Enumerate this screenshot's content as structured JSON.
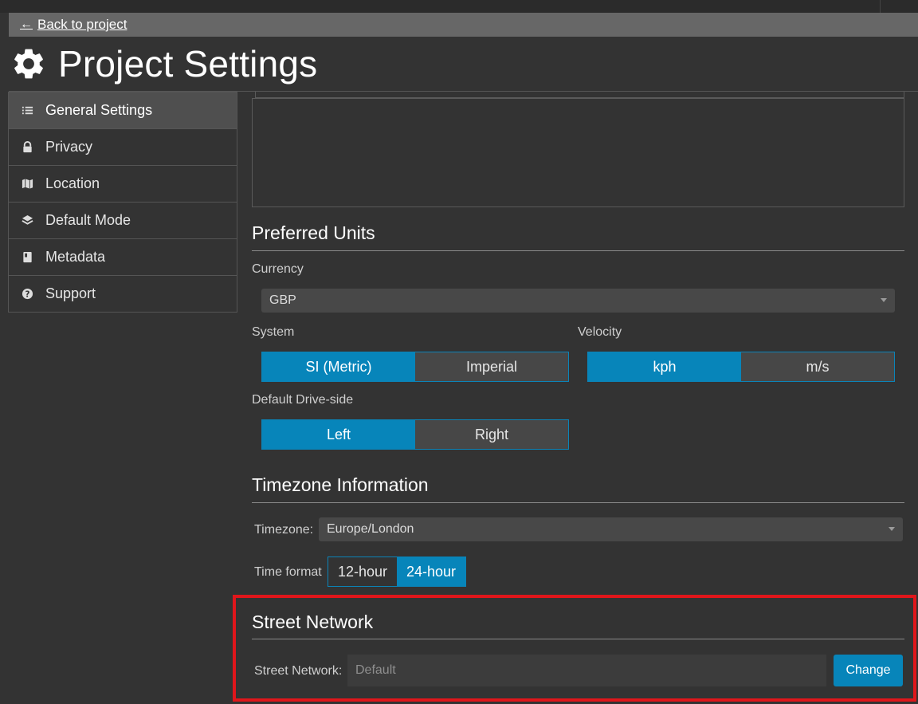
{
  "header": {
    "back_label": "Back to project",
    "page_title": "Project Settings"
  },
  "sidebar": {
    "items": [
      {
        "label": "General Settings",
        "icon": "list-icon",
        "active": true
      },
      {
        "label": "Privacy",
        "icon": "lock-icon",
        "active": false
      },
      {
        "label": "Location",
        "icon": "map-icon",
        "active": false
      },
      {
        "label": "Default Mode",
        "icon": "layers-icon",
        "active": false
      },
      {
        "label": "Metadata",
        "icon": "book-icon",
        "active": false
      },
      {
        "label": "Support",
        "icon": "question-circle-icon",
        "active": false
      }
    ]
  },
  "units": {
    "title": "Preferred Units",
    "currency_label": "Currency",
    "currency_value": "GBP",
    "system_label": "System",
    "system_options": [
      "SI (Metric)",
      "Imperial"
    ],
    "system_selected": "SI (Metric)",
    "velocity_label": "Velocity",
    "velocity_options": [
      "kph",
      "m/s"
    ],
    "velocity_selected": "kph",
    "drive_side_label": "Default Drive-side",
    "drive_side_options": [
      "Left",
      "Right"
    ],
    "drive_side_selected": "Left"
  },
  "timezone": {
    "title": "Timezone Information",
    "timezone_label": "Timezone:",
    "timezone_value": "Europe/London",
    "format_label": "Time format",
    "format_options": [
      "12-hour",
      "24-hour"
    ],
    "format_selected": "24-hour"
  },
  "street": {
    "title": "Street Network",
    "label": "Street Network:",
    "placeholder": "Default",
    "change_label": "Change"
  },
  "colors": {
    "accent": "#0785ba",
    "highlight": "#e0161b",
    "background": "#333333"
  }
}
